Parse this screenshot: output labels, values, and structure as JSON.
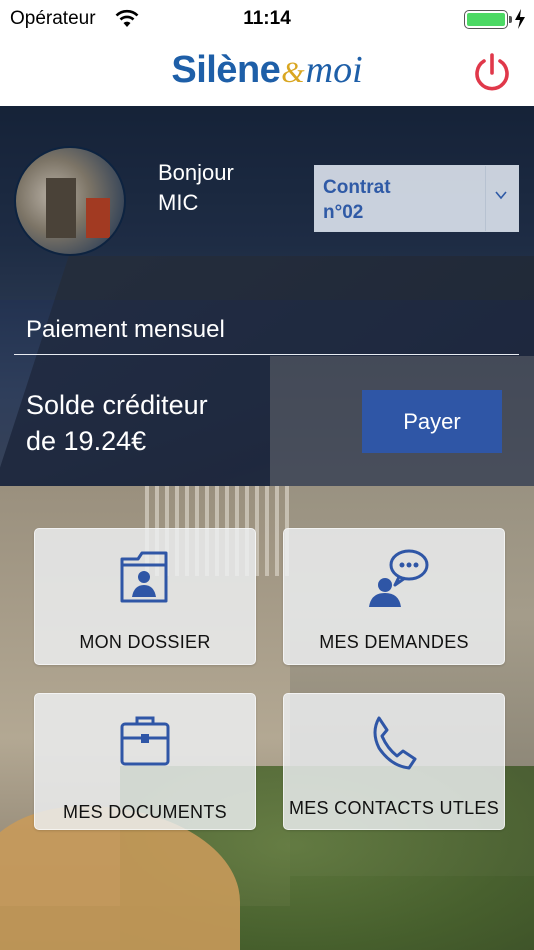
{
  "status_bar": {
    "carrier": "Opérateur",
    "time": "11:14"
  },
  "header": {
    "logo_part1": "Silène",
    "logo_amp": "&",
    "logo_part2": "moi"
  },
  "user": {
    "greeting_line1": "Bonjour",
    "greeting_line2": "MIC",
    "contract_line1": "Contrat",
    "contract_line2": "n°02"
  },
  "payment": {
    "title": "Paiement mensuel",
    "balance_line1": "Solde créditeur",
    "balance_line2": "de 19.24€",
    "pay_label": "Payer"
  },
  "tiles": [
    {
      "label": "MON DOSSIER",
      "icon": "folder-user-icon"
    },
    {
      "label": "MES DEMANDES",
      "icon": "user-chat-icon"
    },
    {
      "label": "MES DOCUMENTS",
      "icon": "briefcase-icon"
    },
    {
      "label": "MES CONTACTS UTLES",
      "icon": "phone-icon"
    }
  ],
  "colors": {
    "brand_blue": "#2f56a6",
    "logo_blue": "#1e5fa8",
    "logo_amp": "#d9a621",
    "power_red": "#e0384a",
    "battery_green": "#4cd964"
  }
}
